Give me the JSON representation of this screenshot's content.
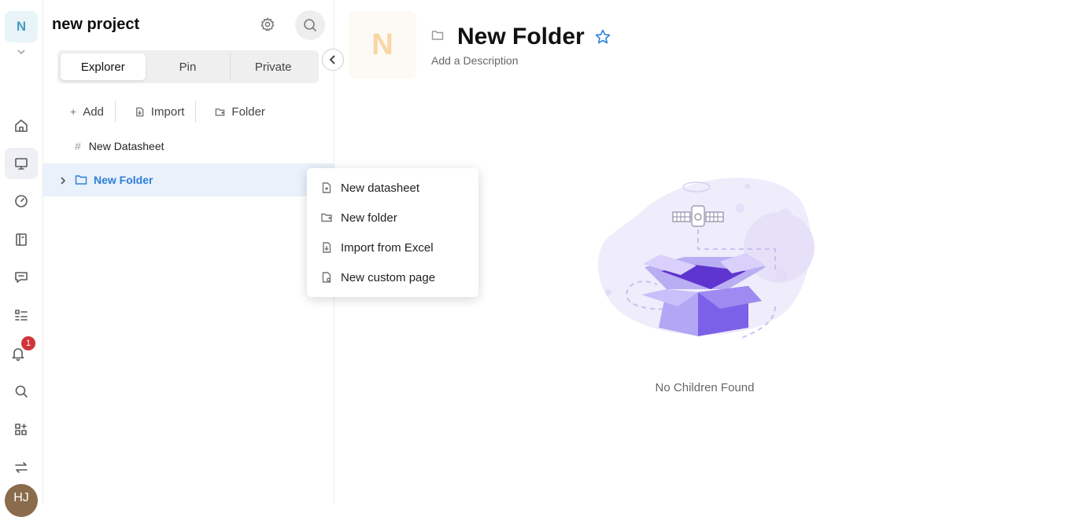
{
  "rail": {
    "workspace_initial": "N",
    "notification_count": "1",
    "user_initials": "HJ",
    "items": [
      {
        "name": "home-icon"
      },
      {
        "name": "workbench-icon",
        "active": true
      },
      {
        "name": "dashboard-icon"
      },
      {
        "name": "templates-icon"
      },
      {
        "name": "chat-icon"
      },
      {
        "name": "tasks-icon"
      },
      {
        "name": "bell-icon"
      },
      {
        "name": "search-icon"
      },
      {
        "name": "apps-icon"
      },
      {
        "name": "switch-icon"
      }
    ]
  },
  "panel": {
    "project_title": "new project",
    "tabs": [
      {
        "label": "Explorer",
        "active": true
      },
      {
        "label": "Pin"
      },
      {
        "label": "Private"
      }
    ],
    "actions": {
      "add": "Add",
      "import": "Import",
      "folder": "Folder"
    },
    "tree": {
      "datasheet": "New Datasheet",
      "folder": "New Folder"
    }
  },
  "context_menu": {
    "items": [
      {
        "label": "New datasheet",
        "icon": "new-datasheet-icon"
      },
      {
        "label": "New folder",
        "icon": "new-folder-icon"
      },
      {
        "label": "Import from Excel",
        "icon": "import-excel-icon"
      },
      {
        "label": "New custom page",
        "icon": "custom-page-icon"
      }
    ]
  },
  "main": {
    "cover_initial": "N",
    "title": "New Folder",
    "description_placeholder": "Add a Description",
    "empty_text": "No Children Found"
  },
  "colors": {
    "accent": "#2f7fd8",
    "selected_row": "#e9f1fb",
    "badge": "#d13438",
    "illustration": "#7b61e8"
  }
}
